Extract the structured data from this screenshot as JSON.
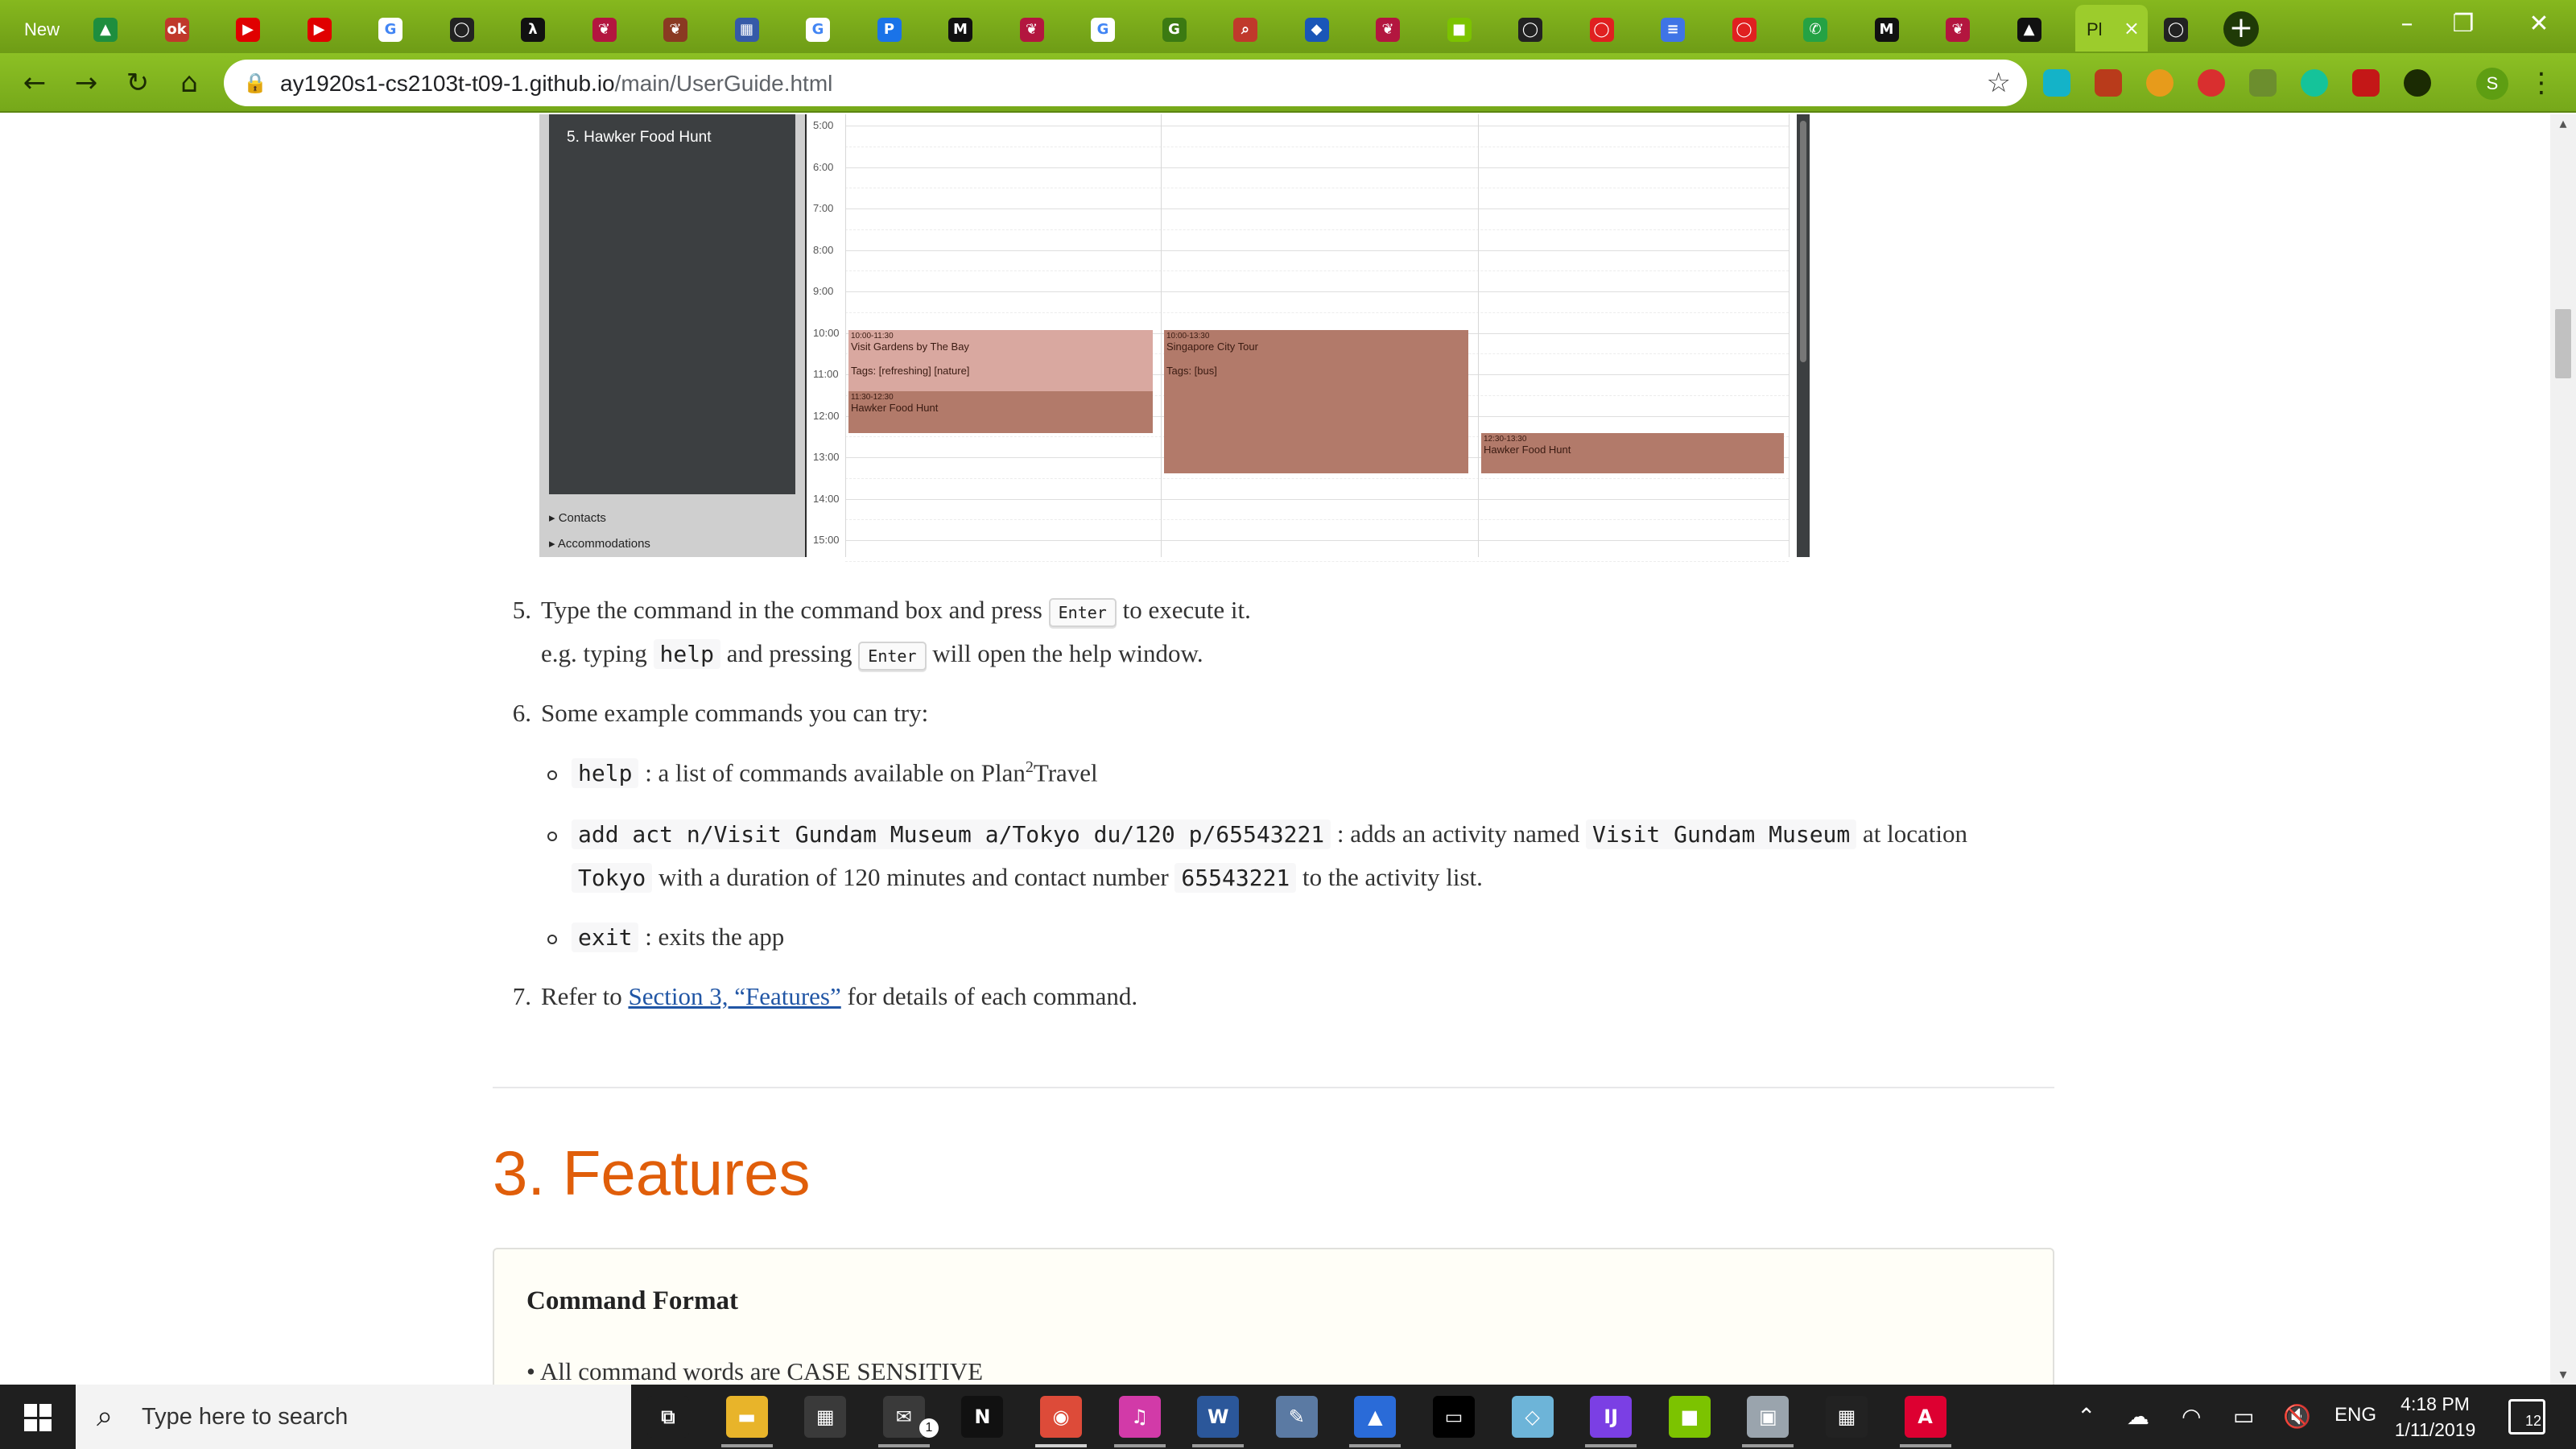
{
  "browser": {
    "first_tab_label": "New",
    "active_tab_label": "Pl",
    "url_host": "ay1920s1-cs2103t-t09-1.github.io",
    "url_path": "/main/UserGuide.html",
    "profile_initial": "S",
    "tab_favicons": [
      {
        "name": "drive-icon",
        "color": "#1e8e3e",
        "glyph": "▲"
      },
      {
        "name": "ok-icon",
        "color": "#c0392b",
        "glyph": "ok"
      },
      {
        "name": "youtube-icon",
        "color": "#e00000",
        "glyph": "▶"
      },
      {
        "name": "youtube-icon",
        "color": "#e00000",
        "glyph": "▶"
      },
      {
        "name": "google-icon",
        "color": "#ffffff",
        "glyph": "G"
      },
      {
        "name": "github-icon",
        "color": "#222222",
        "glyph": "◯"
      },
      {
        "name": "lambda-icon",
        "color": "#111111",
        "glyph": "λ"
      },
      {
        "name": "raspberry-icon",
        "color": "#b3163f",
        "glyph": "❦"
      },
      {
        "name": "raspberry-icon",
        "color": "#8a3a22",
        "glyph": "❦"
      },
      {
        "name": "chart-icon",
        "color": "#355aa8",
        "glyph": "▦"
      },
      {
        "name": "google-icon",
        "color": "#ffffff",
        "glyph": "G"
      },
      {
        "name": "plan-icon",
        "color": "#1a73e8",
        "glyph": "P"
      },
      {
        "name": "medium-icon",
        "color": "#111111",
        "glyph": "M"
      },
      {
        "name": "raspberry-icon",
        "color": "#b3163f",
        "glyph": "❦"
      },
      {
        "name": "google-icon",
        "color": "#ffffff",
        "glyph": "G"
      },
      {
        "name": "gh-icon",
        "color": "#3b7a12",
        "glyph": "G"
      },
      {
        "name": "search-icon",
        "color": "#c0392b",
        "glyph": "⌕"
      },
      {
        "name": "diamond-icon",
        "color": "#1a56b8",
        "glyph": "◆"
      },
      {
        "name": "raspberry-icon",
        "color": "#b3163f",
        "glyph": "❦"
      },
      {
        "name": "cube-icon",
        "color": "#7cc300",
        "glyph": "■"
      },
      {
        "name": "github-icon",
        "color": "#222222",
        "glyph": "◯"
      },
      {
        "name": "oracle-icon",
        "color": "#e02020",
        "glyph": "◯"
      },
      {
        "name": "docs-icon",
        "color": "#3f74e6",
        "glyph": "≡"
      },
      {
        "name": "oracle-icon",
        "color": "#e02020",
        "glyph": "◯"
      },
      {
        "name": "whatsapp-icon",
        "color": "#25a244",
        "glyph": "✆"
      },
      {
        "name": "medium-icon",
        "color": "#111111",
        "glyph": "M"
      },
      {
        "name": "raspberry-icon",
        "color": "#b3163f",
        "glyph": "❦"
      },
      {
        "name": "cap-icon",
        "color": "#111111",
        "glyph": "▲"
      }
    ]
  },
  "app": {
    "list_item": "5.  Hawker Food Hunt",
    "accordion_contacts": "▸  Contacts",
    "accordion_accommodations": "▸  Accommodations",
    "hours": [
      "5:00",
      "6:00",
      "7:00",
      "8:00",
      "9:00",
      "10:00",
      "11:00",
      "12:00",
      "13:00",
      "14:00",
      "15:00"
    ],
    "events": {
      "e1_time": "10:00-11:30",
      "e1_title": "Visit Gardens by The Bay",
      "e1_tags": "Tags: [refreshing] [nature]",
      "e2_time": "11:30-12:30",
      "e2_title": "Hawker Food Hunt",
      "e3_time": "10:00-13:30",
      "e3_title": "Singapore City Tour",
      "e3_tags": "Tags: [bus]",
      "e4_time": "12:30-13:30",
      "e4_title": "Hawker Food Hunt"
    }
  },
  "doc": {
    "step5_num": "5.",
    "step5_a": "Type the command in the command box and press",
    "key_enter": "Enter",
    "step5_b": "to execute it.",
    "step5_eg_a": "e.g. typing",
    "code_help": "help",
    "step5_eg_b": "and pressing",
    "step5_eg_c": "will open the help window.",
    "step6_num": "6.",
    "step6": "Some example commands you can try:",
    "cmd1_desc_a": ": a list of commands available on Plan",
    "cmd1_sup": "2",
    "cmd1_desc_b": "Travel",
    "cmd2_code": "add act n/Visit Gundam Museum a/Tokyo du/120 p/65543221",
    "cmd2_a": ": adds an activity named",
    "cmd2_name": "Visit Gundam Museum",
    "cmd2_b": "at location",
    "cmd2_loc": "Tokyo",
    "cmd2_c": "with a duration of 120 minutes and contact number",
    "cmd2_phone": "65543221",
    "cmd2_d": "to the activity list.",
    "cmd3_code": "exit",
    "cmd3_desc": ": exits the app",
    "step7_num": "7.",
    "step7_a": "Refer to",
    "step7_link": "Section 3, “Features”",
    "step7_b": "for details of each command.",
    "features_title": "3. Features",
    "sidebar_title": "Command Format",
    "sidebar_bullet": "All command words are CASE SENSITIVE"
  },
  "taskbar": {
    "search_placeholder": "Type here to search",
    "mail_badge": "1",
    "lang": "ENG",
    "time": "4:18 PM",
    "date": "1/11/2019",
    "notif_count": "12",
    "apps": [
      {
        "name": "task-view-icon",
        "color": "#1f1f1f",
        "glyph": "⧉"
      },
      {
        "name": "file-explorer-icon",
        "color": "#e8b42a",
        "glyph": "▬"
      },
      {
        "name": "store-icon",
        "color": "#3a3a3a",
        "glyph": "▦"
      },
      {
        "name": "mail-icon",
        "color": "#3a3a3a",
        "glyph": "✉"
      },
      {
        "name": "netflix-icon",
        "color": "#111111",
        "glyph": "N"
      },
      {
        "name": "chrome-icon",
        "color": "#dd4b39",
        "glyph": "◉"
      },
      {
        "name": "itunes-icon",
        "color": "#d23aa8",
        "glyph": "♫"
      },
      {
        "name": "word-icon",
        "color": "#2b579a",
        "glyph": "W"
      },
      {
        "name": "paint-icon",
        "color": "#5b7aa3",
        "glyph": "✎"
      },
      {
        "name": "vertex-icon",
        "color": "#2a6bd8",
        "glyph": "▲"
      },
      {
        "name": "terminal-icon",
        "color": "#000000",
        "glyph": "▭"
      },
      {
        "name": "notes-icon",
        "color": "#6db4d8",
        "glyph": "◇"
      },
      {
        "name": "intellij-icon",
        "color": "#7b3fe4",
        "glyph": "IJ"
      },
      {
        "name": "cube-icon",
        "color": "#7cc300",
        "glyph": "■"
      },
      {
        "name": "remote-icon",
        "color": "#9aa4ad",
        "glyph": "▣"
      },
      {
        "name": "calendar-icon",
        "color": "#222222",
        "glyph": "▦"
      },
      {
        "name": "angular-icon",
        "color": "#dd0031",
        "glyph": "A"
      }
    ]
  },
  "colors": {
    "accent": "#e05e0a",
    "link": "#2156a5",
    "event": "#b27a6a"
  }
}
